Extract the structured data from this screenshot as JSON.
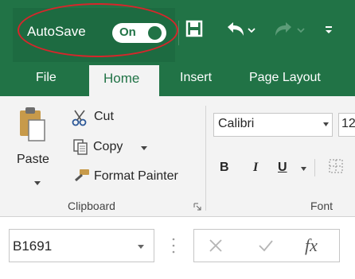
{
  "title_bar": {
    "autosave_label": "AutoSave",
    "autosave_state": "On",
    "quick_access": [
      "save-icon",
      "undo-icon",
      "redo-icon",
      "customize-qat-icon"
    ]
  },
  "tabs": [
    {
      "label": "File",
      "active": false
    },
    {
      "label": "Home",
      "active": true
    },
    {
      "label": "Insert",
      "active": false
    },
    {
      "label": "Page Layout",
      "active": false
    }
  ],
  "clipboard": {
    "paste_label": "Paste",
    "cut_label": "Cut",
    "copy_label": "Copy",
    "format_painter_label": "Format Painter",
    "group_label": "Clipboard"
  },
  "font": {
    "name": "Calibri",
    "size": "12",
    "bold_label": "B",
    "italic_label": "I",
    "underline_label": "U",
    "group_label": "Font"
  },
  "formula_bar": {
    "name_box": "B1691",
    "fx_label": "fx"
  },
  "colors": {
    "excel_green": "#217346",
    "highlight_red": "#d7262b",
    "ribbon_bg": "#f3f3f3"
  }
}
